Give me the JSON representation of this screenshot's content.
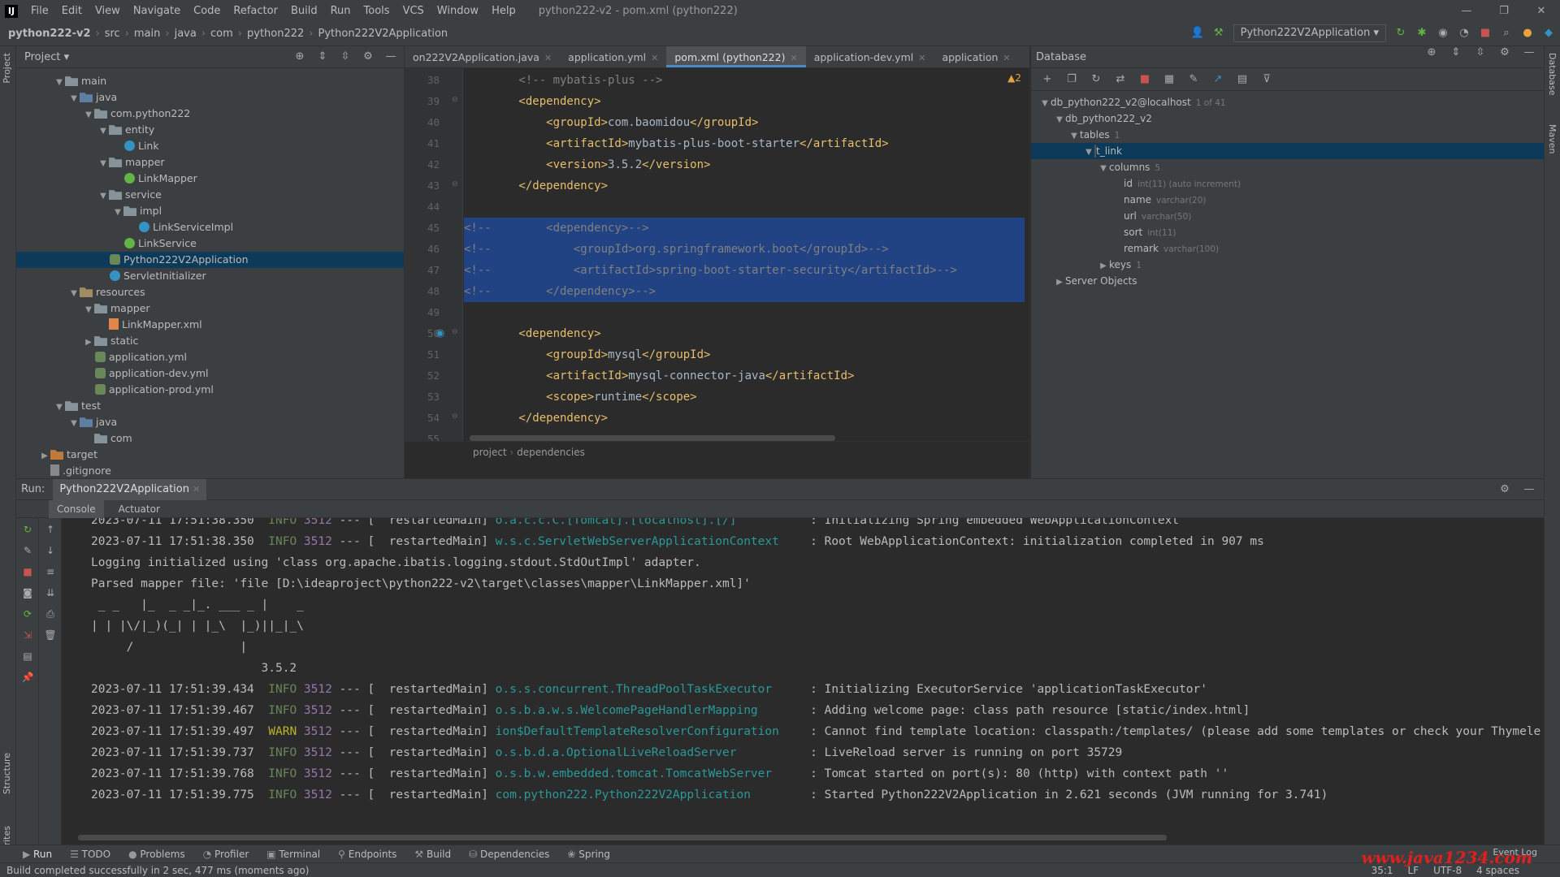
{
  "menubar": {
    "items": [
      "File",
      "Edit",
      "View",
      "Navigate",
      "Code",
      "Refactor",
      "Build",
      "Run",
      "Tools",
      "VCS",
      "Window",
      "Help"
    ],
    "window_title": "python222-v2 - pom.xml (python222)"
  },
  "navbar": {
    "crumbs": [
      "python222-v2",
      "src",
      "main",
      "java",
      "com",
      "python222",
      "Python222V2Application"
    ],
    "run_config": "Python222V2Application"
  },
  "project": {
    "title": "Project",
    "tree": [
      {
        "label": "main",
        "indent": 2,
        "icon": "folder",
        "arrow": "v"
      },
      {
        "label": "java",
        "indent": 3,
        "icon": "folder src",
        "arrow": "v"
      },
      {
        "label": "com.python222",
        "indent": 4,
        "icon": "pkg",
        "arrow": "v"
      },
      {
        "label": "entity",
        "indent": 5,
        "icon": "pkg",
        "arrow": "v"
      },
      {
        "label": "Link",
        "indent": 6,
        "icon": "cls",
        "arrow": ""
      },
      {
        "label": "mapper",
        "indent": 5,
        "icon": "pkg",
        "arrow": "v"
      },
      {
        "label": "LinkMapper",
        "indent": 6,
        "icon": "iface",
        "arrow": ""
      },
      {
        "label": "service",
        "indent": 5,
        "icon": "pkg",
        "arrow": "v"
      },
      {
        "label": "impl",
        "indent": 6,
        "icon": "pkg",
        "arrow": "v"
      },
      {
        "label": "LinkServiceImpl",
        "indent": 7,
        "icon": "cls",
        "arrow": ""
      },
      {
        "label": "LinkService",
        "indent": 6,
        "icon": "iface",
        "arrow": ""
      },
      {
        "label": "Python222V2Application",
        "indent": 5,
        "icon": "spring",
        "arrow": "",
        "selected": true
      },
      {
        "label": "ServletInitializer",
        "indent": 5,
        "icon": "cls",
        "arrow": ""
      },
      {
        "label": "resources",
        "indent": 3,
        "icon": "folder res",
        "arrow": "v"
      },
      {
        "label": "mapper",
        "indent": 4,
        "icon": "folder",
        "arrow": "v"
      },
      {
        "label": "LinkMapper.xml",
        "indent": 5,
        "icon": "xml",
        "arrow": ""
      },
      {
        "label": "static",
        "indent": 4,
        "icon": "folder",
        "arrow": ">"
      },
      {
        "label": "application.yml",
        "indent": 4,
        "icon": "spring",
        "arrow": ""
      },
      {
        "label": "application-dev.yml",
        "indent": 4,
        "icon": "spring",
        "arrow": ""
      },
      {
        "label": "application-prod.yml",
        "indent": 4,
        "icon": "spring",
        "arrow": ""
      },
      {
        "label": "test",
        "indent": 2,
        "icon": "folder",
        "arrow": "v"
      },
      {
        "label": "java",
        "indent": 3,
        "icon": "folder src",
        "arrow": "v"
      },
      {
        "label": "com",
        "indent": 4,
        "icon": "pkg",
        "arrow": ""
      },
      {
        "label": "target",
        "indent": 1,
        "icon": "folder tgt",
        "arrow": ">"
      },
      {
        "label": ".gitignore",
        "indent": 1,
        "icon": "file",
        "arrow": ""
      }
    ]
  },
  "editor": {
    "tabs": [
      {
        "label": "on222V2Application.java",
        "active": false
      },
      {
        "label": "application.yml",
        "active": false
      },
      {
        "label": "pom.xml (python222)",
        "active": true
      },
      {
        "label": "application-dev.yml",
        "active": false
      },
      {
        "label": "application",
        "active": false
      }
    ],
    "inspection": "▲2",
    "lines": [
      {
        "n": "38",
        "parts": [
          [
            "cmt",
            "        <!-- mybatis-plus -->"
          ]
        ]
      },
      {
        "n": "39",
        "parts": [
          [
            "tag",
            "        <dependency>"
          ]
        ]
      },
      {
        "n": "40",
        "parts": [
          [
            "tag",
            "            <groupId>"
          ],
          [
            "txt",
            "com.baomidou"
          ],
          [
            "tag",
            "</groupId>"
          ]
        ]
      },
      {
        "n": "41",
        "parts": [
          [
            "tag",
            "            <artifactId>"
          ],
          [
            "txt",
            "mybatis-plus-boot-starter"
          ],
          [
            "tag",
            "</artifactId>"
          ]
        ]
      },
      {
        "n": "42",
        "parts": [
          [
            "tag",
            "            <version>"
          ],
          [
            "txt",
            "3.5.2"
          ],
          [
            "tag",
            "</version>"
          ]
        ]
      },
      {
        "n": "43",
        "parts": [
          [
            "tag",
            "        </dependency>"
          ]
        ]
      },
      {
        "n": "44",
        "parts": []
      },
      {
        "n": "45",
        "sel": true,
        "parts": [
          [
            "cmt",
            "<!--        <dependency>-->"
          ]
        ]
      },
      {
        "n": "46",
        "sel": true,
        "parts": [
          [
            "cmt",
            "<!--            <groupId>org.springframework.boot</groupId>-->"
          ]
        ]
      },
      {
        "n": "47",
        "sel": true,
        "parts": [
          [
            "cmt",
            "<!--            <artifactId>spring-boot-starter-security</artifactId>-->"
          ]
        ]
      },
      {
        "n": "48",
        "sel": true,
        "parts": [
          [
            "cmt",
            "<!--        </dependency>-->"
          ]
        ]
      },
      {
        "n": "49",
        "parts": []
      },
      {
        "n": "50",
        "parts": [
          [
            "tag",
            "        <dependency>"
          ]
        ]
      },
      {
        "n": "51",
        "parts": [
          [
            "tag",
            "            <groupId>"
          ],
          [
            "txt",
            "mysql"
          ],
          [
            "tag",
            "</groupId>"
          ]
        ]
      },
      {
        "n": "52",
        "parts": [
          [
            "tag",
            "            <artifactId>"
          ],
          [
            "txt",
            "mysql-connector-java"
          ],
          [
            "tag",
            "</artifactId>"
          ]
        ]
      },
      {
        "n": "53",
        "parts": [
          [
            "tag",
            "            <scope>"
          ],
          [
            "txt",
            "runtime"
          ],
          [
            "tag",
            "</scope>"
          ]
        ]
      },
      {
        "n": "54",
        "parts": [
          [
            "tag",
            "        </dependency>"
          ]
        ]
      },
      {
        "n": "55",
        "parts": []
      }
    ],
    "breadcrumbs": [
      "project",
      "dependencies"
    ]
  },
  "database": {
    "title": "Database",
    "tree": [
      {
        "label": "db_python222_v2@localhost",
        "meta": "1 of 41",
        "indent": 0,
        "icon": "db",
        "arrow": "v"
      },
      {
        "label": "db_python222_v2",
        "meta": "",
        "indent": 1,
        "icon": "db",
        "arrow": "v"
      },
      {
        "label": "tables",
        "meta": "1",
        "indent": 2,
        "icon": "folder",
        "arrow": "v"
      },
      {
        "label": "t_link",
        "meta": "",
        "indent": 3,
        "icon": "tbl",
        "arrow": "v",
        "selected": true
      },
      {
        "label": "columns",
        "meta": "5",
        "indent": 4,
        "icon": "folder",
        "arrow": "v"
      },
      {
        "label": "id",
        "meta": "int(11) (auto increment)",
        "indent": 5,
        "icon": "col",
        "arrow": ""
      },
      {
        "label": "name",
        "meta": "varchar(20)",
        "indent": 5,
        "icon": "col",
        "arrow": ""
      },
      {
        "label": "url",
        "meta": "varchar(50)",
        "indent": 5,
        "icon": "col",
        "arrow": ""
      },
      {
        "label": "sort",
        "meta": "int(11)",
        "indent": 5,
        "icon": "col",
        "arrow": ""
      },
      {
        "label": "remark",
        "meta": "varchar(100)",
        "indent": 5,
        "icon": "col",
        "arrow": ""
      },
      {
        "label": "keys",
        "meta": "1",
        "indent": 4,
        "icon": "folder",
        "arrow": ">"
      },
      {
        "label": "Server Objects",
        "meta": "",
        "indent": 1,
        "icon": "folder",
        "arrow": ">"
      }
    ]
  },
  "run": {
    "label": "Run:",
    "tab": "Python222V2Application",
    "subtabs": [
      "Console",
      "Actuator"
    ],
    "log": [
      {
        "type": "log",
        "ts": "2023-07-11 17:51:38.350",
        "lvl": "INFO",
        "pid": "3512",
        "thread": "restartedMain",
        "logger": "o.a.c.c.C.[Tomcat].[localhost].[/]",
        "msg": ": Initializing Spring embedded WebApplicationContext"
      },
      {
        "type": "log",
        "ts": "2023-07-11 17:51:38.350",
        "lvl": "INFO",
        "pid": "3512",
        "thread": "restartedMain",
        "logger": "w.s.c.ServletWebServerApplicationContext",
        "msg": ": Root WebApplicationContext: initialization completed in 907 ms"
      },
      {
        "type": "plain",
        "text": "Logging initialized using 'class org.apache.ibatis.logging.stdout.StdOutImpl' adapter."
      },
      {
        "type": "plain",
        "text": "Parsed mapper file: 'file [D:\\ideaproject\\python222-v2\\target\\classes\\mapper\\LinkMapper.xml]'"
      },
      {
        "type": "plain",
        "text": " _ _   |_  _ _|_. ___ _ |    _"
      },
      {
        "type": "plain",
        "text": "| | |\\/|_)(_| | |_\\  |_)||_|_\\"
      },
      {
        "type": "plain",
        "text": "     /               |"
      },
      {
        "type": "plain",
        "text": "                        3.5.2"
      },
      {
        "type": "log",
        "ts": "2023-07-11 17:51:39.434",
        "lvl": "INFO",
        "pid": "3512",
        "thread": "restartedMain",
        "logger": "o.s.s.concurrent.ThreadPoolTaskExecutor",
        "msg": ": Initializing ExecutorService 'applicationTaskExecutor'"
      },
      {
        "type": "log",
        "ts": "2023-07-11 17:51:39.467",
        "lvl": "INFO",
        "pid": "3512",
        "thread": "restartedMain",
        "logger": "o.s.b.a.w.s.WelcomePageHandlerMapping",
        "msg": ": Adding welcome page: class path resource [static/index.html]"
      },
      {
        "type": "log",
        "ts": "2023-07-11 17:51:39.497",
        "lvl": "WARN",
        "pid": "3512",
        "thread": "restartedMain",
        "logger": "ion$DefaultTemplateResolverConfiguration",
        "msg": ": Cannot find template location: classpath:/templates/ (please add some templates or check your Thymele"
      },
      {
        "type": "log",
        "ts": "2023-07-11 17:51:39.737",
        "lvl": "INFO",
        "pid": "3512",
        "thread": "restartedMain",
        "logger": "o.s.b.d.a.OptionalLiveReloadServer",
        "msg": ": LiveReload server is running on port 35729"
      },
      {
        "type": "log",
        "ts": "2023-07-11 17:51:39.768",
        "lvl": "INFO",
        "pid": "3512",
        "thread": "restartedMain",
        "logger": "o.s.b.w.embedded.tomcat.TomcatWebServer",
        "msg": ": Tomcat started on port(s): 80 (http) with context path ''"
      },
      {
        "type": "log",
        "ts": "2023-07-11 17:51:39.775",
        "lvl": "INFO",
        "pid": "3512",
        "thread": "restartedMain",
        "logger": "com.python222.Python222V2Application",
        "msg": ": Started Python222V2Application in 2.621 seconds (JVM running for 3.741)"
      }
    ]
  },
  "toolwindows": [
    "Run",
    "TODO",
    "Problems",
    "Profiler",
    "Terminal",
    "Endpoints",
    "Build",
    "Dependencies",
    "Spring"
  ],
  "status": {
    "message": "Build completed successfully in 2 sec, 477 ms (moments ago)",
    "position": "35:1",
    "line_sep": "LF",
    "encoding": "UTF-8",
    "indent": "4 spaces",
    "event_log": "Event Log"
  },
  "side_labels": {
    "left_top": "Project",
    "left_mid": "Structure",
    "left_bottom": "Favorites",
    "right_top": "Database",
    "right_mid": "Maven"
  },
  "watermark": "www.java1234.com",
  "colors": {
    "selection": "#214283",
    "accent": "#4a88c7",
    "tag": "#e8bf6a",
    "comment": "#808080"
  }
}
